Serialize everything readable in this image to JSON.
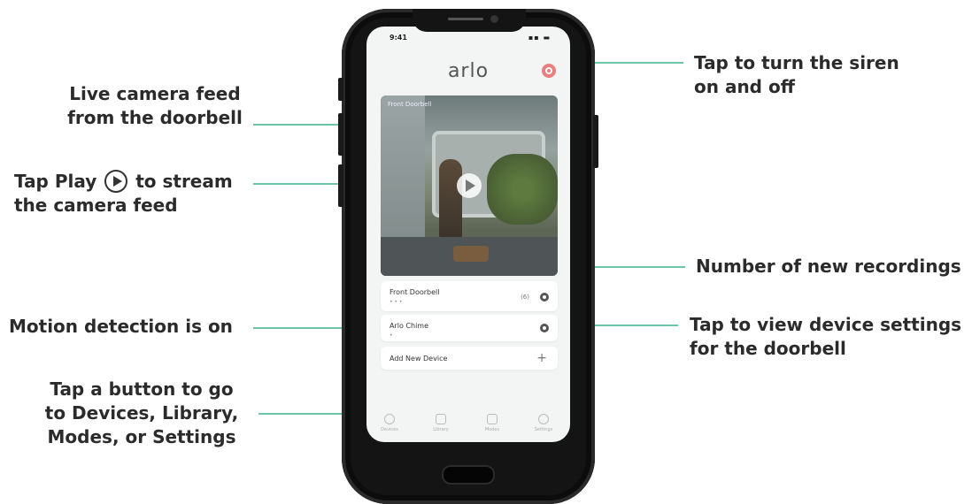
{
  "callouts": {
    "live_feed": [
      "Live camera feed",
      "from the doorbell"
    ],
    "play": {
      "before": "Tap Play",
      "after": "to stream",
      "line2": "the camera feed"
    },
    "motion": "Motion detection is on",
    "nav": [
      "Tap a button to go",
      "to Devices, Library,",
      "Modes, or Settings"
    ],
    "siren": [
      "Tap to turn the siren",
      "on and off"
    ],
    "recordings": "Number of new recordings",
    "settings": [
      "Tap to view device settings",
      "for the doorbell"
    ]
  },
  "phone": {
    "logo": "arlo",
    "status_time": "9:41",
    "feed_label": "Front Doorbell",
    "cards": [
      {
        "title": "Front Doorbell",
        "sub": "•  •  •",
        "badge": "(6)"
      },
      {
        "title": "Arlo Chime",
        "sub": "•"
      },
      {
        "title": "Add New Device"
      }
    ],
    "nav_items": [
      "Devices",
      "Library",
      "Modes",
      "Settings"
    ]
  },
  "colors": {
    "leader": "#6cc6a6",
    "siren": "#ea7d7d",
    "phone_body": "#141414"
  }
}
